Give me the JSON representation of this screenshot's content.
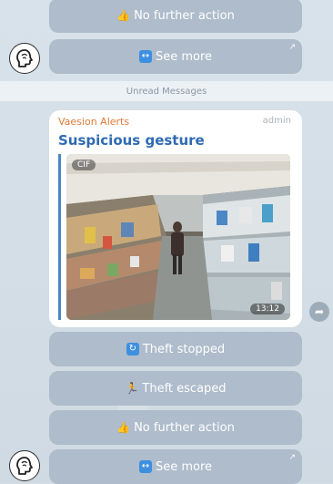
{
  "keyboard_top": {
    "no_further_action": {
      "emoji": "👍",
      "label": "No further action"
    },
    "see_more": {
      "emoji": "↔",
      "label": "See more",
      "corner": "↗"
    }
  },
  "unread_separator": "Unread Messages",
  "message": {
    "sender": "Vaesion Alerts",
    "role": "admin",
    "title": "Suspicious gesture",
    "media": {
      "badge": "CIF",
      "duration": "13:12"
    }
  },
  "keyboard_bottom": {
    "theft_stopped": {
      "emoji": "↻",
      "label": "Theft stopped"
    },
    "theft_escaped": {
      "emoji": "🏃",
      "label": "Theft escaped"
    },
    "no_further_action": {
      "emoji": "👍",
      "label": "No further action"
    },
    "see_more": {
      "emoji": "↔",
      "label": "See more",
      "corner": "↗"
    }
  },
  "icons": {
    "share": "share-arrow-icon",
    "avatar": "head-silhouette-icon"
  },
  "colors": {
    "sender": "#e07b39",
    "title": "#2f6bb3",
    "button_bg": "#aebccb",
    "chat_bg": "#d2dde6"
  }
}
